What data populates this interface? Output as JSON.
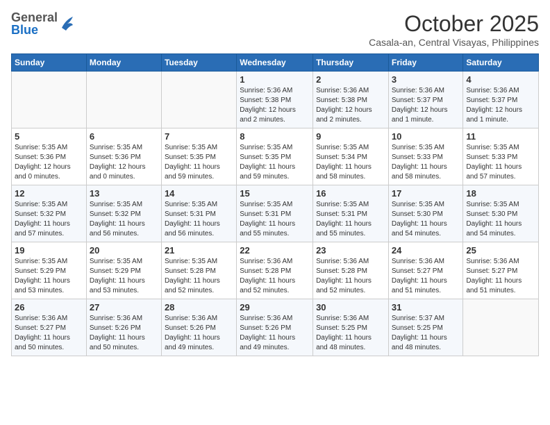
{
  "header": {
    "logo_general": "General",
    "logo_blue": "Blue",
    "month_title": "October 2025",
    "location": "Casala-an, Central Visayas, Philippines"
  },
  "weekdays": [
    "Sunday",
    "Monday",
    "Tuesday",
    "Wednesday",
    "Thursday",
    "Friday",
    "Saturday"
  ],
  "weeks": [
    [
      {
        "day": "",
        "info": ""
      },
      {
        "day": "",
        "info": ""
      },
      {
        "day": "",
        "info": ""
      },
      {
        "day": "1",
        "info": "Sunrise: 5:36 AM\nSunset: 5:38 PM\nDaylight: 12 hours\nand 2 minutes."
      },
      {
        "day": "2",
        "info": "Sunrise: 5:36 AM\nSunset: 5:38 PM\nDaylight: 12 hours\nand 2 minutes."
      },
      {
        "day": "3",
        "info": "Sunrise: 5:36 AM\nSunset: 5:37 PM\nDaylight: 12 hours\nand 1 minute."
      },
      {
        "day": "4",
        "info": "Sunrise: 5:36 AM\nSunset: 5:37 PM\nDaylight: 12 hours\nand 1 minute."
      }
    ],
    [
      {
        "day": "5",
        "info": "Sunrise: 5:35 AM\nSunset: 5:36 PM\nDaylight: 12 hours\nand 0 minutes."
      },
      {
        "day": "6",
        "info": "Sunrise: 5:35 AM\nSunset: 5:36 PM\nDaylight: 12 hours\nand 0 minutes."
      },
      {
        "day": "7",
        "info": "Sunrise: 5:35 AM\nSunset: 5:35 PM\nDaylight: 11 hours\nand 59 minutes."
      },
      {
        "day": "8",
        "info": "Sunrise: 5:35 AM\nSunset: 5:35 PM\nDaylight: 11 hours\nand 59 minutes."
      },
      {
        "day": "9",
        "info": "Sunrise: 5:35 AM\nSunset: 5:34 PM\nDaylight: 11 hours\nand 58 minutes."
      },
      {
        "day": "10",
        "info": "Sunrise: 5:35 AM\nSunset: 5:33 PM\nDaylight: 11 hours\nand 58 minutes."
      },
      {
        "day": "11",
        "info": "Sunrise: 5:35 AM\nSunset: 5:33 PM\nDaylight: 11 hours\nand 57 minutes."
      }
    ],
    [
      {
        "day": "12",
        "info": "Sunrise: 5:35 AM\nSunset: 5:32 PM\nDaylight: 11 hours\nand 57 minutes."
      },
      {
        "day": "13",
        "info": "Sunrise: 5:35 AM\nSunset: 5:32 PM\nDaylight: 11 hours\nand 56 minutes."
      },
      {
        "day": "14",
        "info": "Sunrise: 5:35 AM\nSunset: 5:31 PM\nDaylight: 11 hours\nand 56 minutes."
      },
      {
        "day": "15",
        "info": "Sunrise: 5:35 AM\nSunset: 5:31 PM\nDaylight: 11 hours\nand 55 minutes."
      },
      {
        "day": "16",
        "info": "Sunrise: 5:35 AM\nSunset: 5:31 PM\nDaylight: 11 hours\nand 55 minutes."
      },
      {
        "day": "17",
        "info": "Sunrise: 5:35 AM\nSunset: 5:30 PM\nDaylight: 11 hours\nand 54 minutes."
      },
      {
        "day": "18",
        "info": "Sunrise: 5:35 AM\nSunset: 5:30 PM\nDaylight: 11 hours\nand 54 minutes."
      }
    ],
    [
      {
        "day": "19",
        "info": "Sunrise: 5:35 AM\nSunset: 5:29 PM\nDaylight: 11 hours\nand 53 minutes."
      },
      {
        "day": "20",
        "info": "Sunrise: 5:35 AM\nSunset: 5:29 PM\nDaylight: 11 hours\nand 53 minutes."
      },
      {
        "day": "21",
        "info": "Sunrise: 5:35 AM\nSunset: 5:28 PM\nDaylight: 11 hours\nand 52 minutes."
      },
      {
        "day": "22",
        "info": "Sunrise: 5:36 AM\nSunset: 5:28 PM\nDaylight: 11 hours\nand 52 minutes."
      },
      {
        "day": "23",
        "info": "Sunrise: 5:36 AM\nSunset: 5:28 PM\nDaylight: 11 hours\nand 52 minutes."
      },
      {
        "day": "24",
        "info": "Sunrise: 5:36 AM\nSunset: 5:27 PM\nDaylight: 11 hours\nand 51 minutes."
      },
      {
        "day": "25",
        "info": "Sunrise: 5:36 AM\nSunset: 5:27 PM\nDaylight: 11 hours\nand 51 minutes."
      }
    ],
    [
      {
        "day": "26",
        "info": "Sunrise: 5:36 AM\nSunset: 5:27 PM\nDaylight: 11 hours\nand 50 minutes."
      },
      {
        "day": "27",
        "info": "Sunrise: 5:36 AM\nSunset: 5:26 PM\nDaylight: 11 hours\nand 50 minutes."
      },
      {
        "day": "28",
        "info": "Sunrise: 5:36 AM\nSunset: 5:26 PM\nDaylight: 11 hours\nand 49 minutes."
      },
      {
        "day": "29",
        "info": "Sunrise: 5:36 AM\nSunset: 5:26 PM\nDaylight: 11 hours\nand 49 minutes."
      },
      {
        "day": "30",
        "info": "Sunrise: 5:36 AM\nSunset: 5:25 PM\nDaylight: 11 hours\nand 48 minutes."
      },
      {
        "day": "31",
        "info": "Sunrise: 5:37 AM\nSunset: 5:25 PM\nDaylight: 11 hours\nand 48 minutes."
      },
      {
        "day": "",
        "info": ""
      }
    ]
  ]
}
